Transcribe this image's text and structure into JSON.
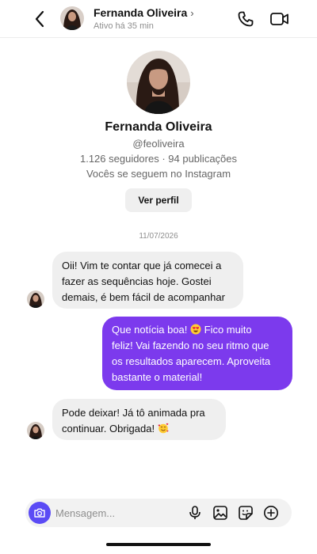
{
  "header": {
    "name": "Fernanda Oliveira",
    "status": "Ativo há 35 min"
  },
  "profile": {
    "name": "Fernanda Oliveira",
    "handle": "@feoliveira",
    "stats": "1.126 seguidores · 94 publicações",
    "follow_note": "Vocês se seguem no Instagram",
    "view_profile_label": "Ver perfil"
  },
  "date_label": "11/07/2026",
  "messages": [
    {
      "direction": "in",
      "lines": [
        "Oii! Vim te contar que já comecei a",
        "fazer as sequências hoje. Gostei",
        "demais, é bem fácil de acompanhar"
      ]
    },
    {
      "direction": "out",
      "lines": [
        "Que notícia boa! ",
        " Fico muito",
        "feliz! Vai fazendo no seu ritmo que",
        "os resultados aparecem. Aproveita",
        "bastante o material!"
      ],
      "emoji": "heart-eyes-emoji"
    },
    {
      "direction": "in",
      "lines": [
        "Pode deixar! Já tô animada pra",
        "continuar. Obrigada! "
      ],
      "emoji": "smiling-hearts-emoji"
    }
  ],
  "composer": {
    "placeholder": "Mensagem..."
  },
  "colors": {
    "outgoing_bubble": "#7c3aed",
    "incoming_bubble": "#efefef",
    "camera_button": "#5b4bf5"
  }
}
